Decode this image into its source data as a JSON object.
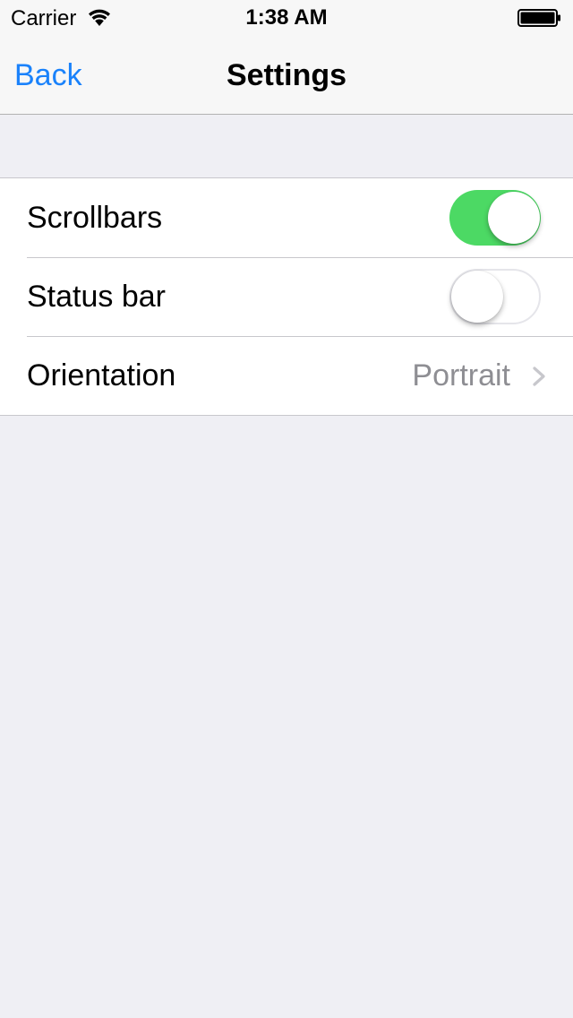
{
  "status_bar": {
    "carrier": "Carrier",
    "time": "1:38 AM",
    "icons": [
      "wifi-icon",
      "battery-icon"
    ]
  },
  "nav_bar": {
    "back_label": "Back",
    "title": "Settings"
  },
  "settings": {
    "scrollbars": {
      "label": "Scrollbars",
      "enabled": true
    },
    "status_bar": {
      "label": "Status bar",
      "enabled": false
    },
    "orientation": {
      "label": "Orientation",
      "value": "Portrait"
    }
  },
  "colors": {
    "accent": "#1a82fb",
    "switch_on": "#4cd964",
    "background": "#efeff4",
    "detail": "#8e8e93"
  }
}
